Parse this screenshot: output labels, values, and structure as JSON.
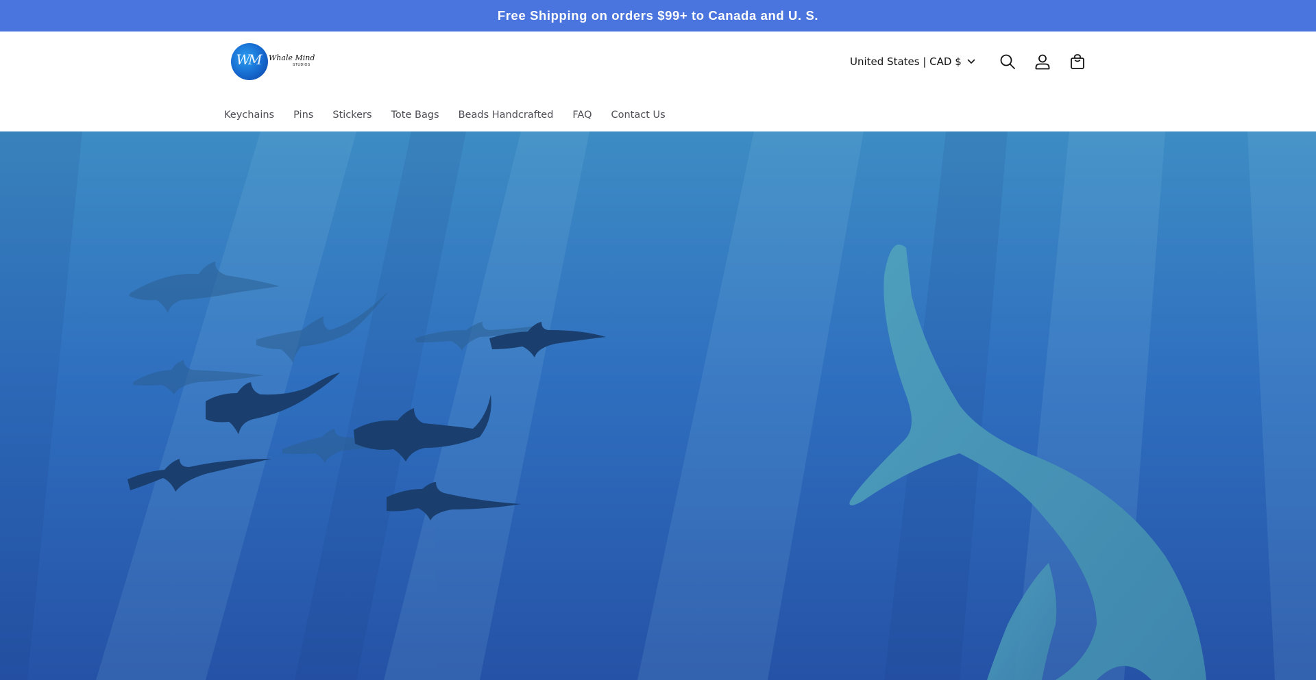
{
  "announcement": {
    "text": "Free Shipping on orders $99+ to Canada and U. S."
  },
  "header": {
    "logo": {
      "monogram": "WM",
      "wordmark": "Whale Mind",
      "sub": "STUDIOS"
    },
    "locale_label": "United States | CAD $",
    "icons": {
      "locale_caret": "chevron-down-icon",
      "search": "search-icon",
      "account": "account-icon",
      "cart": "cart-icon"
    }
  },
  "nav": {
    "items": [
      {
        "label": "Keychains"
      },
      {
        "label": "Pins"
      },
      {
        "label": "Stickers"
      },
      {
        "label": "Tote Bags"
      },
      {
        "label": "Beads Handcrafted"
      },
      {
        "label": "FAQ"
      },
      {
        "label": "Contact Us"
      }
    ]
  },
  "hero": {
    "image": "underwater-illustration-hammerhead-sharks-and-whale-tail"
  },
  "colors": {
    "announcement_bg": "#4a74de",
    "ocean": "#2d6dbf",
    "whale": "#4a98b6",
    "shark": "#1a3f6e"
  }
}
